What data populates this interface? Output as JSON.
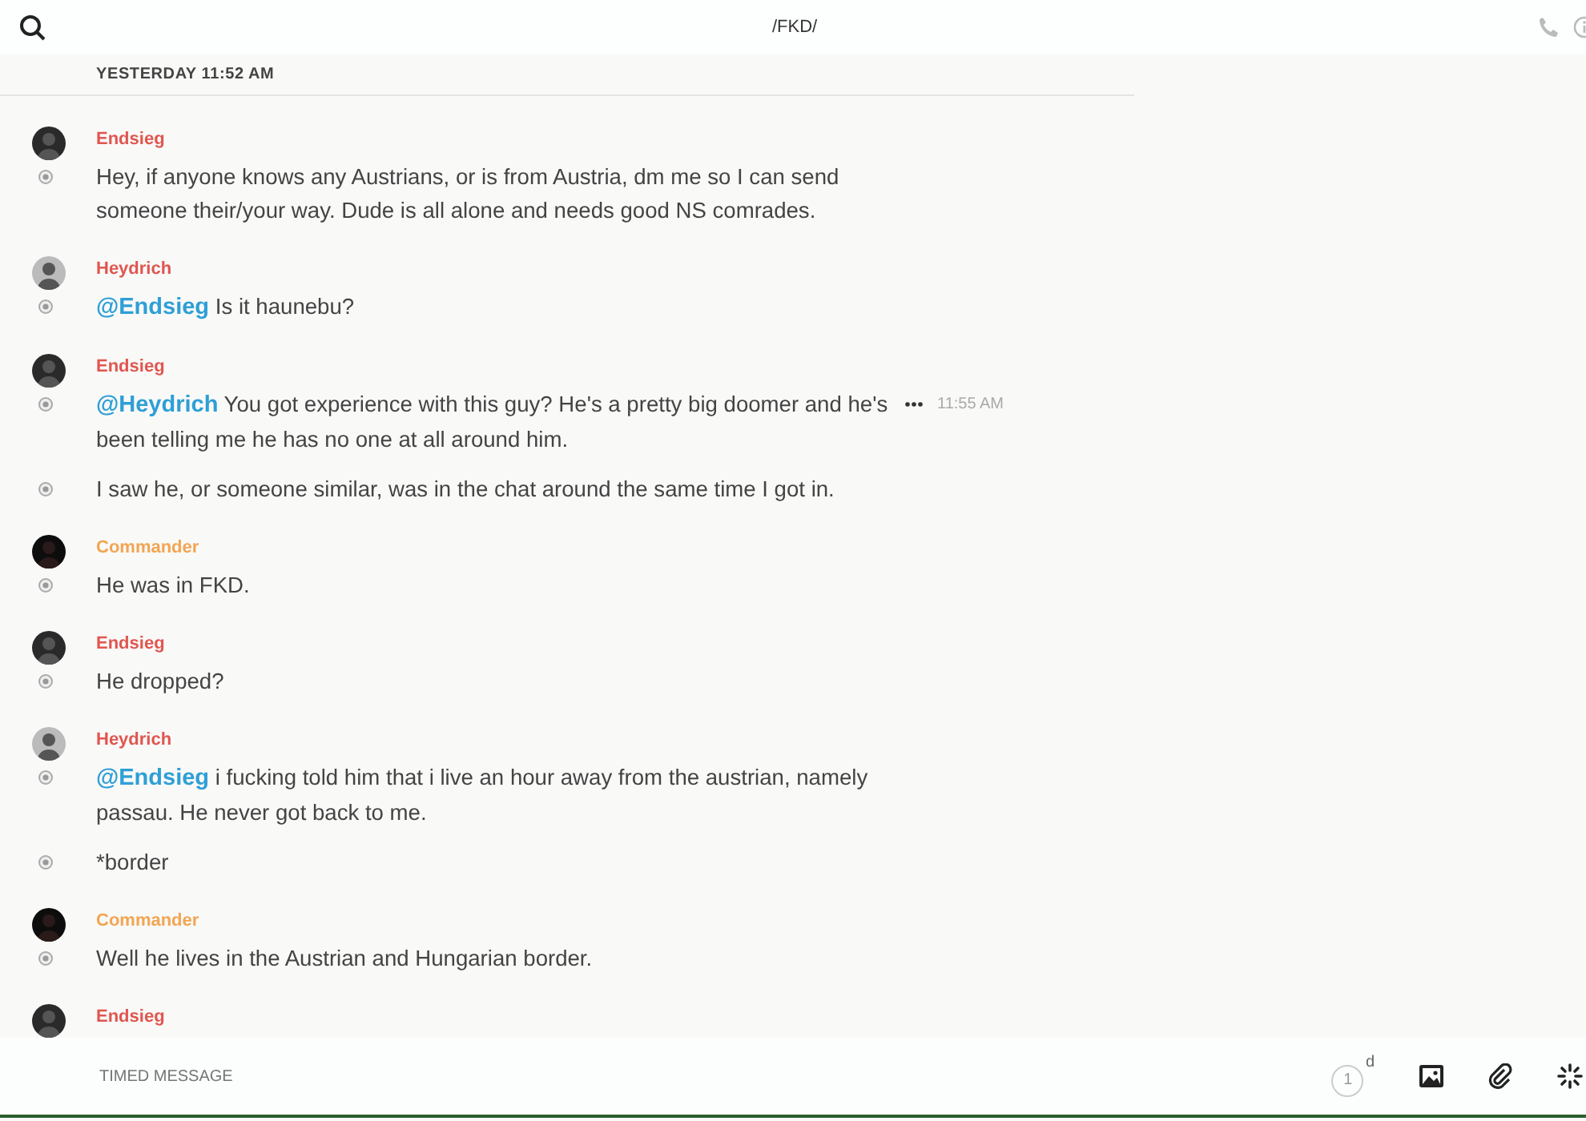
{
  "header": {
    "title": "/FKD/"
  },
  "date_divider": "YESTERDAY 11:52 AM",
  "messages": [
    {
      "author": "Endsieg",
      "color": "#e0564f",
      "avatar": {
        "kind": "dark"
      },
      "rows": [
        {
          "text": "Hey, if anyone knows any Austrians, or is from Austria, dm me so I can send someone their/your way. Dude is all alone and needs good NS comrades."
        }
      ]
    },
    {
      "author": "Heydrich",
      "color": "#e0564f",
      "avatar": {
        "kind": "light"
      },
      "rows": [
        {
          "mention": "@Endsieg",
          "text": "Is it haunebu?"
        }
      ]
    },
    {
      "author": "Endsieg",
      "color": "#e0564f",
      "avatar": {
        "kind": "dark"
      },
      "rows": [
        {
          "mention": "@Heydrich",
          "text": "You got experience with this guy? He's a pretty big doomer and he's been telling me he has no one at all around him.",
          "time": "11:55 AM"
        },
        {
          "text": "I saw he, or someone similar, was in the chat around the same time I got in."
        }
      ]
    },
    {
      "author": "Commander",
      "color": "#f2a552",
      "avatar": {
        "kind": "black"
      },
      "rows": [
        {
          "text": "He was in FKD."
        }
      ]
    },
    {
      "author": "Endsieg",
      "color": "#e0564f",
      "avatar": {
        "kind": "dark"
      },
      "rows": [
        {
          "text": "He dropped?"
        }
      ]
    },
    {
      "author": "Heydrich",
      "color": "#e0564f",
      "avatar": {
        "kind": "light"
      },
      "rows": [
        {
          "mention": "@Endsieg",
          "text": "i fucking told him that i live an hour away from the austrian, namely passau. He never got back to me."
        },
        {
          "text": "*border"
        }
      ]
    },
    {
      "author": "Commander",
      "color": "#f2a552",
      "avatar": {
        "kind": "black"
      },
      "rows": [
        {
          "text": "Well he lives in the Austrian and Hungarian border."
        }
      ]
    },
    {
      "author": "Endsieg",
      "color": "#e0564f",
      "avatar": {
        "kind": "dark"
      }
    }
  ],
  "composer": {
    "placeholder": "TIMED MESSAGE",
    "timer": "1",
    "timer_unit": "d"
  }
}
